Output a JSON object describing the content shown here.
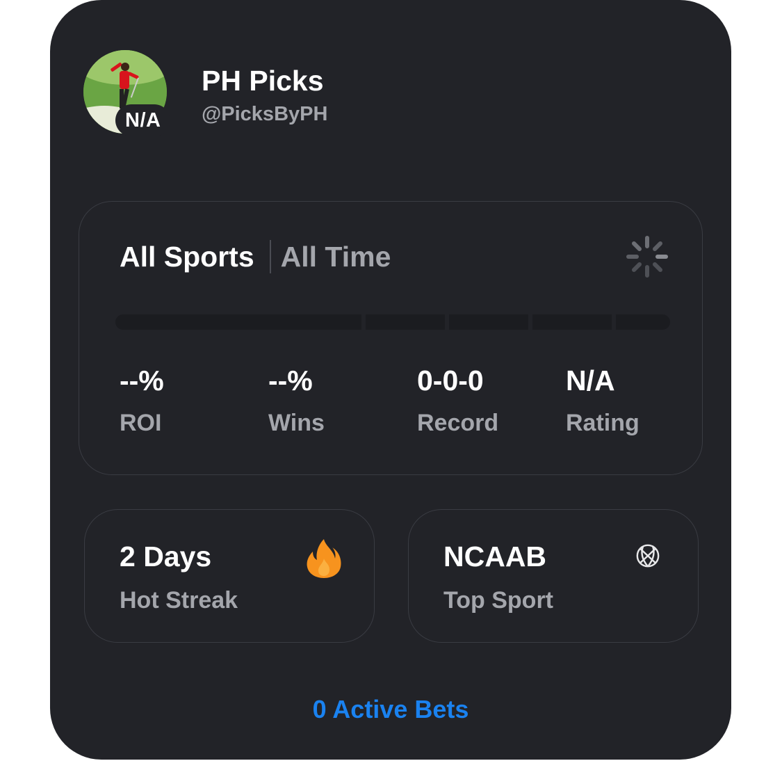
{
  "profile": {
    "display_name": "PH Picks",
    "handle": "@PicksByPH",
    "badge": "N/A"
  },
  "filters": {
    "sport": "All Sports",
    "time": "All Time",
    "loading_icon": "loading-spinner-icon"
  },
  "stats": [
    {
      "value": "--%",
      "label": "ROI"
    },
    {
      "value": "--%",
      "label": "Wins"
    },
    {
      "value": "0-0-0",
      "label": "Record"
    },
    {
      "value": "N/A",
      "label": "Rating"
    }
  ],
  "hot_streak": {
    "value": "2 Days",
    "label": "Hot Streak",
    "icon": "fire-icon"
  },
  "top_sport": {
    "value": "NCAAB",
    "label": "Top Sport",
    "icon": "basketball-icon"
  },
  "footer": {
    "active_bets": "0 Active Bets"
  },
  "colors": {
    "card_background": "#222328",
    "primary_text": "#ffffff",
    "secondary_text": "#a4a6ac",
    "accent_link": "#1a82f0",
    "fire": "#f7931e"
  }
}
